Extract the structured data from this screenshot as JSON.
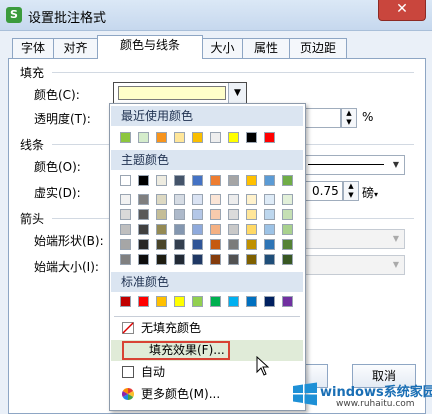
{
  "window": {
    "title": "设置批注格式",
    "app_icon": "S",
    "close_glyph": "✕"
  },
  "tabs": [
    {
      "label": "字体"
    },
    {
      "label": "对齐"
    },
    {
      "label": "颜色与线条"
    },
    {
      "label": "大小"
    },
    {
      "label": "属性"
    },
    {
      "label": "页边距"
    }
  ],
  "fill": {
    "section": "填充",
    "color_label": "颜色(C):",
    "transparency_label": "透明度(T):",
    "transparency_unit": "%",
    "color_value": "#ffffc9"
  },
  "line": {
    "section": "线条",
    "color_label": "颜色(O):",
    "dash_label": "虚实(D):",
    "weight_value": "0.75",
    "weight_unit": "磅"
  },
  "arrows": {
    "section": "箭头",
    "start_style_label": "始端形状(B):",
    "start_size_label": "始端大小(I):"
  },
  "popup": {
    "recent_header": "最近使用颜色",
    "recent_colors": [
      "#8dc63f",
      "#d4eccb",
      "#f7941d",
      "#ffe699",
      "#f9be00",
      "#eeeeee",
      "#ffff00",
      "#000000",
      "#ff0000"
    ],
    "theme_header": "主题颜色",
    "theme_top": [
      "#ffffff",
      "#000000",
      "#eeece1",
      "#44546a",
      "#4472c4",
      "#ed7d31",
      "#a5a5a5",
      "#ffc000",
      "#5b9bd5",
      "#70ad47"
    ],
    "theme_columns": [
      [
        "#f2f2f2",
        "#d9d9d9",
        "#bfbfbf",
        "#a6a6a6",
        "#808080"
      ],
      [
        "#7f7f7f",
        "#595959",
        "#404040",
        "#262626",
        "#0d0d0d"
      ],
      [
        "#ddd9c3",
        "#c4bd97",
        "#948a54",
        "#4a452a",
        "#1e1c11"
      ],
      [
        "#d6dce4",
        "#adb9ca",
        "#8497b0",
        "#333f4f",
        "#222a35"
      ],
      [
        "#dae3f3",
        "#b4c7e7",
        "#8faadc",
        "#2f5597",
        "#1f3864"
      ],
      [
        "#fbe5d6",
        "#f8cbad",
        "#f4b183",
        "#c55a11",
        "#843c0c"
      ],
      [
        "#ededed",
        "#dbdbdb",
        "#c9c9c9",
        "#7b7b7b",
        "#525252"
      ],
      [
        "#fff2cc",
        "#ffe699",
        "#ffd966",
        "#bf9000",
        "#7f6000"
      ],
      [
        "#deebf7",
        "#bdd7ee",
        "#9dc3e6",
        "#2e75b6",
        "#1f4e79"
      ],
      [
        "#e2f0d9",
        "#c5e0b4",
        "#a9d18e",
        "#548235",
        "#385723"
      ]
    ],
    "standard_header": "标准颜色",
    "standard_colors": [
      "#c00000",
      "#ff0000",
      "#ffc000",
      "#ffff00",
      "#92d050",
      "#00b050",
      "#00b0f0",
      "#0070c0",
      "#002060",
      "#7030a0"
    ],
    "no_fill": "无填充颜色",
    "fill_effects": "填充效果(F)...",
    "automatic": "自动",
    "more_colors": "更多颜色(M)..."
  },
  "buttons": {
    "cancel": "取消"
  },
  "watermark": {
    "title": "windows系统家园",
    "url": "www.ruhaitu.com"
  }
}
